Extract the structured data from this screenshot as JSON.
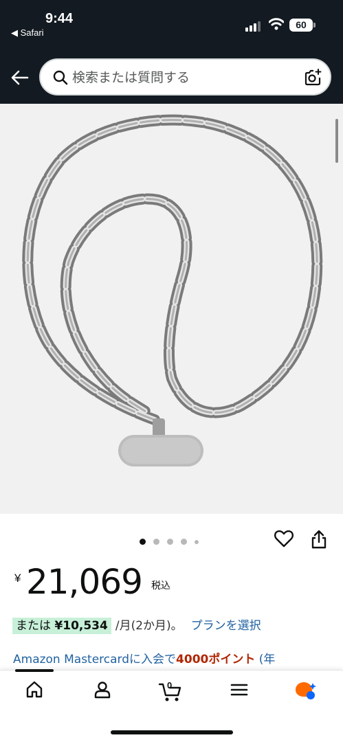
{
  "status_bar": {
    "time": "9:44",
    "back_app": "◀ Safari",
    "battery": "60"
  },
  "search": {
    "placeholder": "検索または質問する"
  },
  "gallery": {
    "image_count": 5,
    "active_index": 0
  },
  "price": {
    "currency": "¥",
    "amount": "21,069",
    "tax_label": "税込"
  },
  "installment": {
    "or_label": "または",
    "amount": "¥10,534",
    "per_month": "/月(2か月)。",
    "plan_link": "プランを選択"
  },
  "card_promo": {
    "text": "Amazon Mastercardに入会で",
    "points": "4000ポイント",
    "rest": " (年"
  },
  "cart": {
    "count": "0"
  },
  "colors": {
    "header_bg": "#131a22",
    "link": "#2162a1",
    "price_red": "#b12704",
    "badge_green": "#c8f0d9"
  }
}
